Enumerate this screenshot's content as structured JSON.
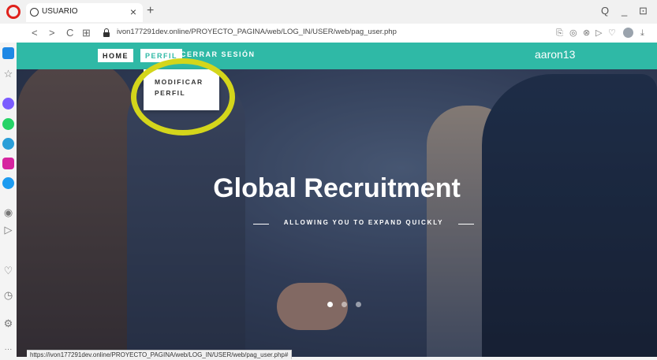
{
  "browser": {
    "tab_title": "USUARIO",
    "tab_close": "×",
    "new_tab": "+",
    "url": "ivon177291dev.online/PROYECTO_PAGINA/web/LOG_IN/USER/web/pag_user.php",
    "status_url": "https://ivon177291dev.online/PROYECTO_PAGINA/web/LOG_IN/USER/web/pag_user.php#",
    "nav_back": "<",
    "nav_forward": ">",
    "nav_reload": "C",
    "nav_grid": "⊞",
    "win_search": "Q",
    "win_min": "_",
    "win_max": "⊡",
    "sidebar_more": "···"
  },
  "site": {
    "nav": {
      "home": "HOME",
      "perfil": "PERFIL",
      "logout": "CERRAR SESIÓN",
      "user": "aaron13"
    },
    "dropdown": {
      "modificar_perfil": "MODIFICAR PERFIL"
    },
    "hero": {
      "title": "Global Recruitment",
      "subtitle": "ALLOWING YOU TO EXPAND QUICKLY"
    },
    "carousel": {
      "slides": 3,
      "active_slide": 1
    }
  },
  "colors": {
    "nav_bar": "#2fb9a6",
    "highlight_ring": "#d4d61b",
    "opera_red": "#e0211b"
  }
}
